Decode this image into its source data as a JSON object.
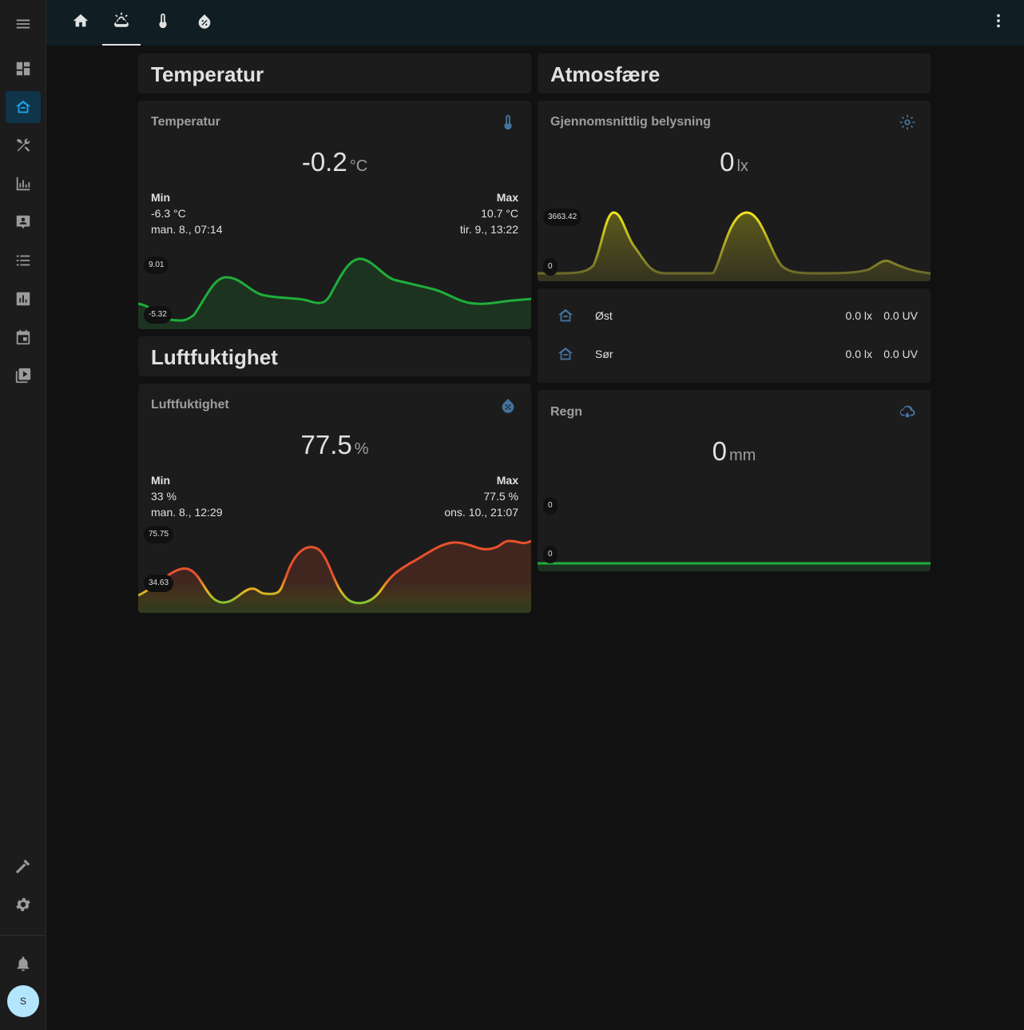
{
  "sidebar": {
    "items": [
      {
        "name": "menu-icon"
      },
      {
        "name": "dashboard-icon"
      },
      {
        "name": "home-climate-icon"
      },
      {
        "name": "tools-icon"
      },
      {
        "name": "energy-icon"
      },
      {
        "name": "logbook-icon"
      },
      {
        "name": "list-icon"
      },
      {
        "name": "history-icon"
      },
      {
        "name": "calendar-icon"
      },
      {
        "name": "media-icon"
      },
      {
        "name": "developer-tools-icon"
      },
      {
        "name": "settings-icon"
      },
      {
        "name": "notifications-icon"
      }
    ],
    "avatar_initial": "S"
  },
  "topbar": {
    "tabs": [
      "home-icon",
      "weather-icon",
      "thermometer-icon",
      "water-percent-icon"
    ],
    "active_tab": 1
  },
  "sections": {
    "temperature_title": "Temperatur",
    "humidity_title": "Luftfuktighet",
    "atmosphere_title": "Atmosfære"
  },
  "temperature_card": {
    "name": "Temperatur",
    "value": "-0.2",
    "unit": "°C",
    "min_label": "Min",
    "min_value": "-6.3 °C",
    "min_time": "man. 8., 07:14",
    "max_label": "Max",
    "max_value": "10.7 °C",
    "max_time": "tir. 9., 13:22",
    "graph_max": "9.01",
    "graph_min": "-5.32"
  },
  "humidity_card": {
    "name": "Luftfuktighet",
    "value": "77.5",
    "unit": "%",
    "min_label": "Min",
    "min_value": "33 %",
    "min_time": "man. 8., 12:29",
    "max_label": "Max",
    "max_value": "77.5 %",
    "max_time": "ons. 10., 21:07",
    "graph_max": "75.75",
    "graph_min": "34.63"
  },
  "illuminance_card": {
    "name": "Gjennomsnittlig belysning",
    "value": "0",
    "unit": "lx",
    "graph_max": "3663.42",
    "graph_min": "0"
  },
  "entities": [
    {
      "name": "Øst",
      "lux": "0.0 lx",
      "uv": "0.0 UV"
    },
    {
      "name": "Sør",
      "lux": "0.0 lx",
      "uv": "0.0 UV"
    }
  ],
  "rain_card": {
    "name": "Regn",
    "value": "0",
    "unit": "mm",
    "graph_max": "0",
    "graph_min": "0"
  },
  "colors": {
    "accent": "#1fa3e6",
    "icon": "#44739e",
    "green": "#1fae3a",
    "yellow": "#f4e81b",
    "orange": "#e8512c"
  }
}
